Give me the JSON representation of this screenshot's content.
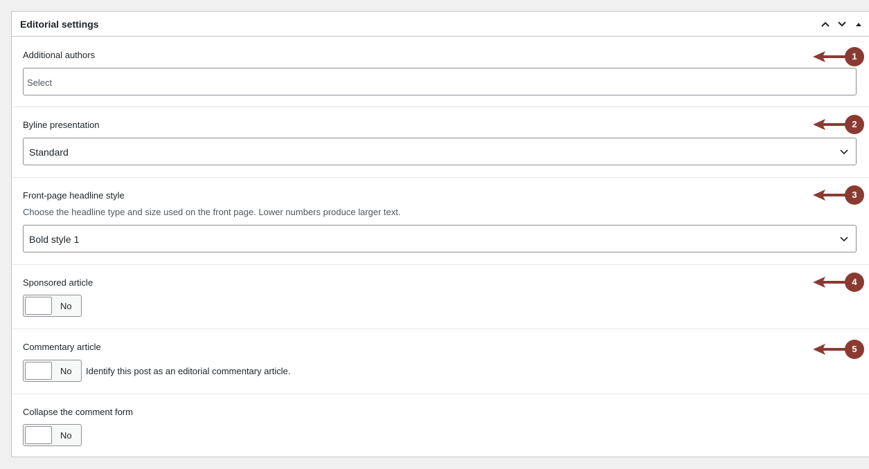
{
  "panel": {
    "title": "Editorial settings",
    "buttons": [
      "move-up",
      "move-down",
      "collapse"
    ]
  },
  "fields": {
    "additional_authors": {
      "label": "Additional authors",
      "placeholder": "Select"
    },
    "byline": {
      "label": "Byline presentation",
      "value": "Standard"
    },
    "headline": {
      "label": "Front-page headline style",
      "description": "Choose the headline type and size used on the front page. Lower numbers produce larger text.",
      "value": "Bold style 1"
    },
    "sponsored": {
      "label": "Sponsored article",
      "toggle": "No"
    },
    "commentary": {
      "label": "Commentary article",
      "toggle": "No",
      "description": "Identify this post as an editorial commentary article."
    },
    "collapse_comments": {
      "label": "Collapse the comment form",
      "toggle": "No"
    }
  },
  "annotations": [
    "1",
    "2",
    "3",
    "4",
    "5"
  ],
  "colors": {
    "annotation": "#8b3a32",
    "border": "#c3c4c7"
  }
}
